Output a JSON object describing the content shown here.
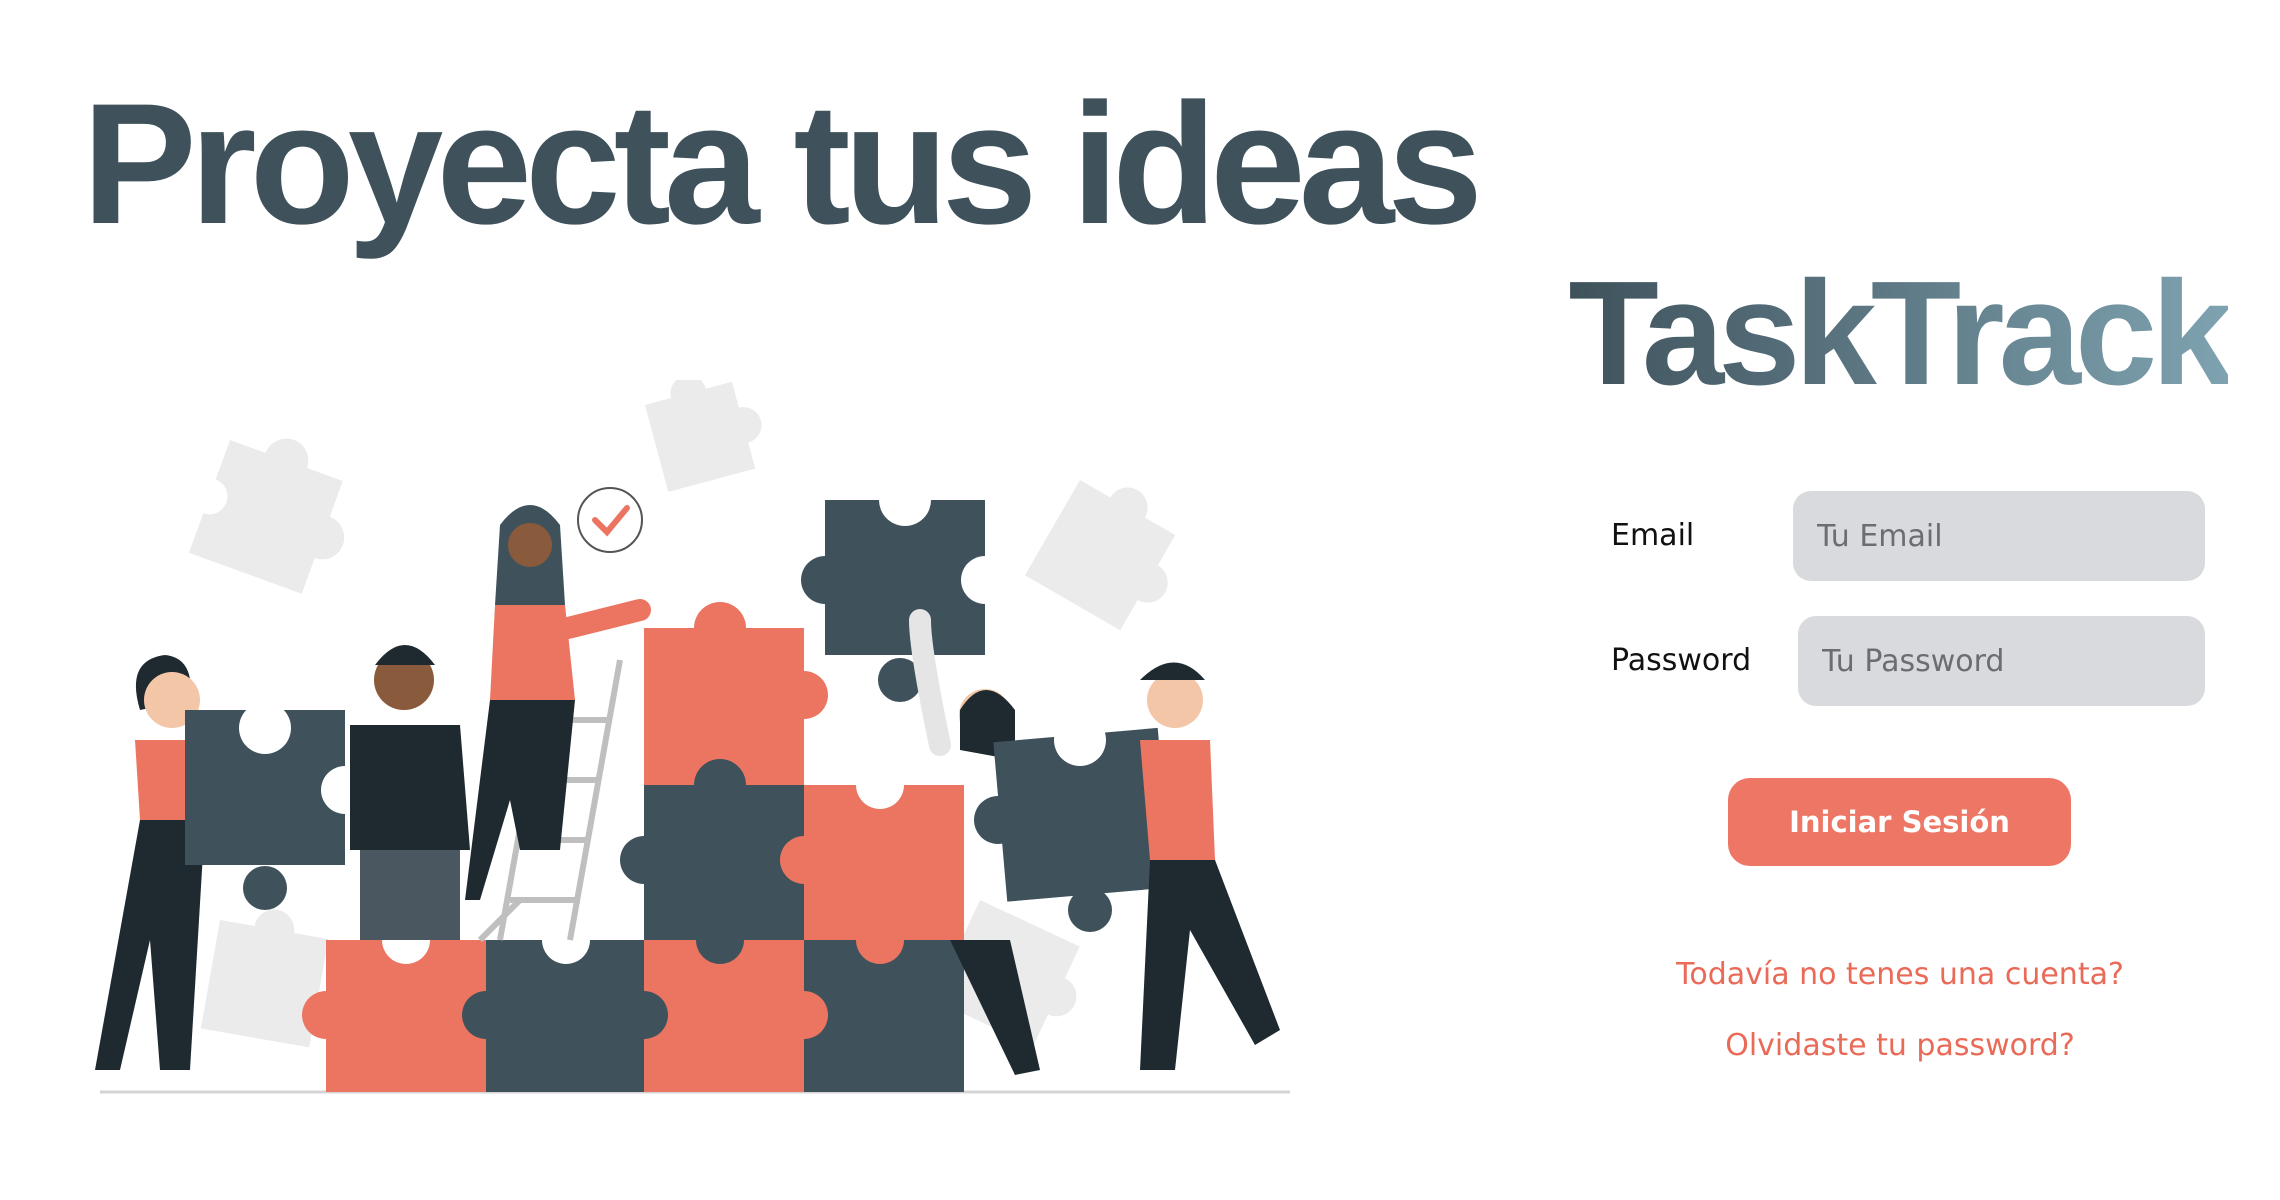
{
  "hero": {
    "headline": "Proyecta tus ideas"
  },
  "brand": {
    "name": "TaskTrack",
    "gradient_start": "#3f525c",
    "gradient_end": "#7fa3b1"
  },
  "form": {
    "email_label": "Email",
    "email_placeholder": "Tu Email",
    "email_value": "",
    "password_label": "Password",
    "password_placeholder": "Tu Password",
    "password_value": "",
    "submit_label": "Iniciar Sesión"
  },
  "links": {
    "signup": "Todavía no tenes una cuenta?",
    "forgot": "Olvidaste tu password?"
  },
  "colors": {
    "headline": "#3f525c",
    "accent": "#ee7664",
    "puzzle_dark": "#3f525c",
    "puzzle_light": "#ec7562",
    "puzzle_faint": "#ebebeb",
    "input_bg": "#d9dadd"
  },
  "illustration": {
    "name": "team-assembling-puzzle-illustration"
  }
}
